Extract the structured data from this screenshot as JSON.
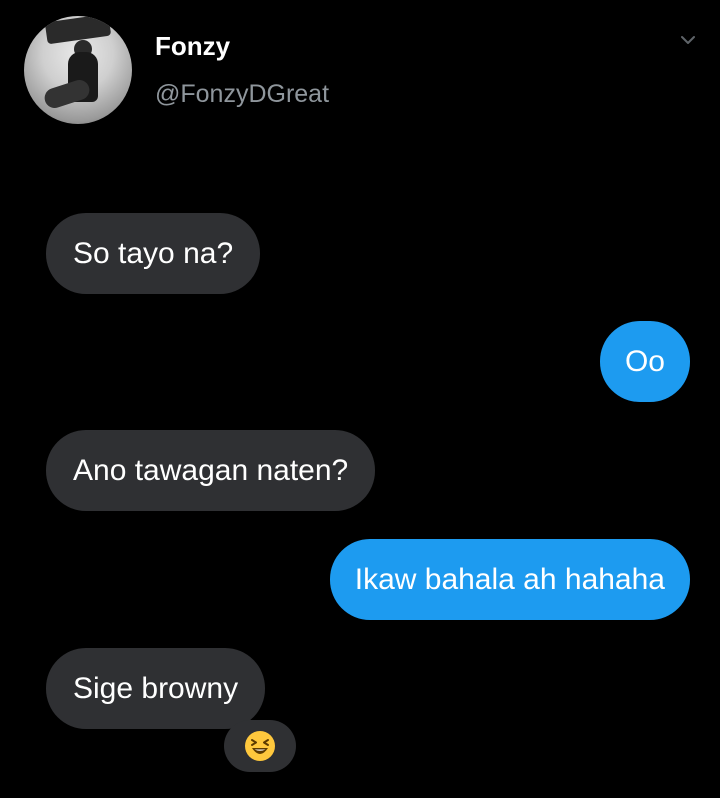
{
  "profile": {
    "display_name": "Fonzy",
    "handle": "@FonzyDGreat",
    "avatar_icon": "avatar-photo"
  },
  "header": {
    "menu_icon": "chevron-down-icon"
  },
  "messages": [
    {
      "direction": "incoming",
      "text": "So tayo na?"
    },
    {
      "direction": "outgoing",
      "text": "Oo"
    },
    {
      "direction": "incoming",
      "text": "Ano tawagan naten?"
    },
    {
      "direction": "outgoing",
      "text": "Ikaw bahala ah hahaha"
    },
    {
      "direction": "incoming",
      "text": "Sige browny"
    }
  ],
  "reaction": {
    "icon": "laughing-face-icon",
    "on_message": 4
  },
  "colors": {
    "background": "#000000",
    "incoming_bubble": "#2f3033",
    "outgoing_bubble": "#1d9bf0",
    "handle_text": "#8f969c",
    "emoji_yellow": "#ffc83d"
  }
}
